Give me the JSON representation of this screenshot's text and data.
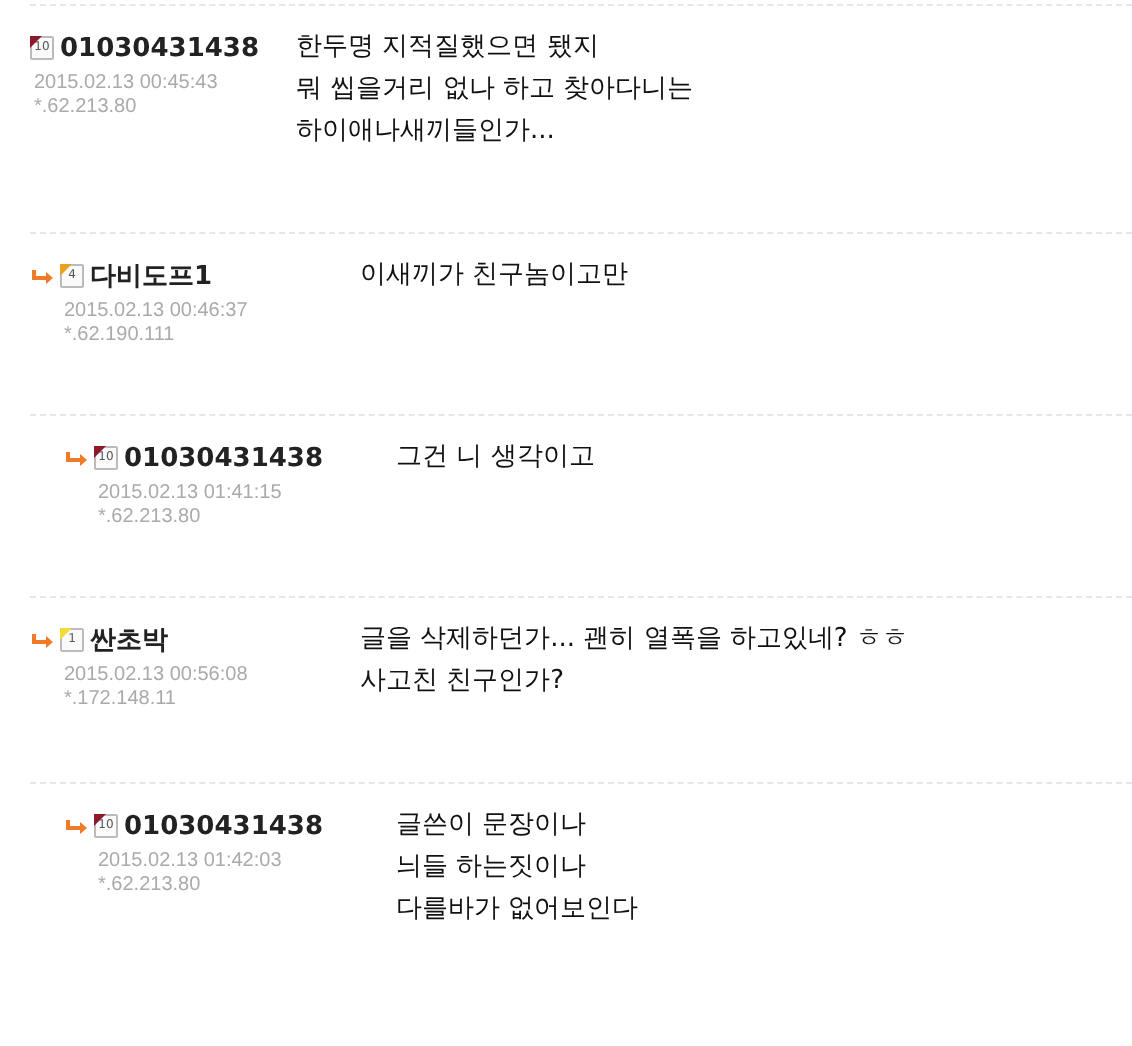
{
  "comments": [
    {
      "level_badge": "10",
      "color": "#8b1a2b",
      "author": "01030431438",
      "date": "2015.02.13 00:45:43",
      "ip": "*.62.213.80",
      "text": "한두명 지적질했으면 됐지\n뭐 씹을거리 없나 하고 찾아다니는\n하이애나새끼들인가...",
      "children": [
        {
          "level_badge": "4",
          "color": "#e8a020",
          "author": "다비도프1",
          "date": "2015.02.13 00:46:37",
          "ip": "*.62.190.111",
          "text": "이새끼가 친구놈이고만",
          "children": [
            {
              "level_badge": "10",
              "color": "#8b1a2b",
              "author": "01030431438",
              "date": "2015.02.13 01:41:15",
              "ip": "*.62.213.80",
              "text": "그건 니 생각이고"
            }
          ]
        },
        {
          "level_badge": "1",
          "color": "#f2dc3c",
          "author": "싼초박",
          "date": "2015.02.13 00:56:08",
          "ip": "*.172.148.11",
          "text": "글을 삭제하던가... 괜히 열폭을 하고있네? ㅎㅎ\n사고친 친구인가?",
          "children": [
            {
              "level_badge": "10",
              "color": "#8b1a2b",
              "author": "01030431438",
              "date": "2015.02.13 01:42:03",
              "ip": "*.62.213.80",
              "text": "글쓴이 문장이나\n늬들 하는짓이나\n다를바가 없어보인다"
            }
          ]
        }
      ]
    }
  ]
}
